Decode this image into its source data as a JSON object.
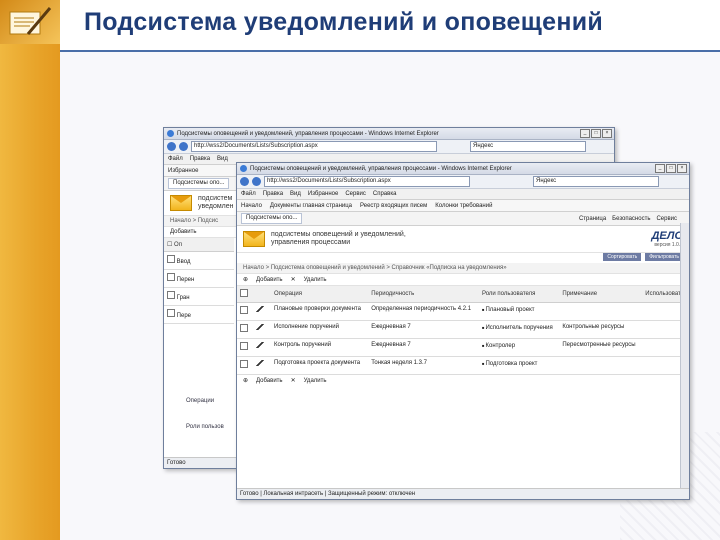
{
  "slide": {
    "title": "Подсистема уведомлений и оповещений"
  },
  "colors": {
    "title": "#1f3d77",
    "sidebar": "#e8a42a",
    "window_border": "#6f7f9c"
  },
  "back_window": {
    "title": "Подсистемы оповещений и уведомлений, управления процессами - Windows Internet Explorer",
    "address": "http://wss2/Documents/Lists/Subscription.aspx",
    "search": "Яндекс",
    "menu": [
      "Файл",
      "Правка",
      "Вид",
      "Избранное"
    ],
    "links_label": "Избранное",
    "tab_label": "Подсистемы опо...",
    "header_line1": "подсистем",
    "header_line2": "уведомлен",
    "crumb": "Начало > Подсис",
    "add_label": "Добавить",
    "col_operation_short": "Оп",
    "rows": [
      "Ввод",
      "Перен",
      "Гран",
      "Пере"
    ],
    "side_links": [
      "Операции",
      "Роли пользов"
    ],
    "status": "Готово"
  },
  "front_window": {
    "title": "Подсистемы оповещений и уведомлений, управления процессами - Windows Internet Explorer",
    "address": "http://wss2/Documents/Lists/Subscription.aspx",
    "search": "Яндекс",
    "menu": [
      "Файл",
      "Правка",
      "Вид",
      "Избранное",
      "Сервис",
      "Справка"
    ],
    "links": [
      "Начало",
      "Документы главная страница",
      "Реестр входящих писем",
      "Колонки требований"
    ],
    "tab_label": "Подсистемы опо...",
    "tab_tools": [
      "Страница",
      "Безопасность",
      "Сервис"
    ],
    "header_title": "подсистемы оповещений и уведомлений, управления процессами",
    "logo_name": "ДЕЛО",
    "logo_version": "версия 1.0.0",
    "sort_buttons": [
      "Сортировать",
      "Фильтровать"
    ],
    "crumb": "Начало > Подсистема оповещений и уведомлений > Справочник «Подписка на уведомления»",
    "add_label": "Добавить",
    "delete_label": "Удалить",
    "columns": [
      "Операция",
      "Периодичность",
      "Роли пользователя",
      "Примечание",
      "Использовать"
    ],
    "rows": [
      {
        "operation": "Плановые проверки документа",
        "period": "Определенная периодичность 4.2.1",
        "roles": "Плановый проект",
        "note": ""
      },
      {
        "operation": "Исполнение поручений",
        "period": "Ежедневная 7",
        "roles": "Исполнитель поручения",
        "note": "Контрольные ресурсы"
      },
      {
        "operation": "Контроль поручений",
        "period": "Ежедневная 7",
        "roles": "Контролер",
        "note": "Пересмотренные ресурсы"
      },
      {
        "operation": "Подготовка проекта документа",
        "period": "Тонкая неделя 1.3.7",
        "roles": "Подготовка проект",
        "note": ""
      }
    ],
    "status": "Готово | Локальная интрасеть | Защищенный режим: отключен"
  }
}
